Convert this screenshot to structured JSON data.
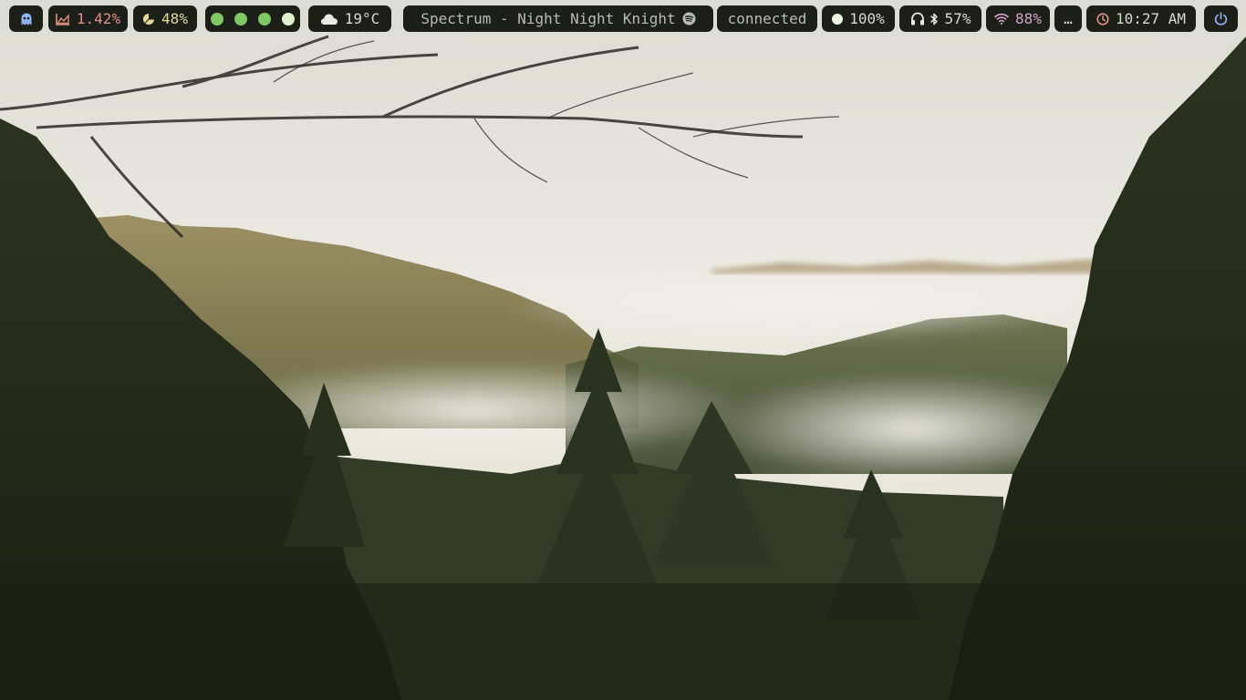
{
  "bar": {
    "launcher": {
      "icon": "ghost-icon"
    },
    "cpu": {
      "icon": "chart-area-icon",
      "value": "1.42%"
    },
    "memory": {
      "icon": "pie-chart-icon",
      "value": "48%"
    },
    "workspaces": [
      {
        "color": "#7fc864",
        "active": false
      },
      {
        "color": "#7fc864",
        "active": false
      },
      {
        "color": "#7fc864",
        "active": false
      },
      {
        "color": "#dff1cf",
        "active": true
      }
    ],
    "weather": {
      "icon": "cloud-icon",
      "value": "19°C"
    },
    "media": {
      "title": "Spectrum - Night Night Knight",
      "icon": "spotify-icon"
    },
    "vpn": {
      "status": "connected"
    },
    "brightness": {
      "icon": "brightness-dot-icon",
      "value": "100%"
    },
    "bluetooth": {
      "icons": [
        "headphones-icon",
        "bluetooth-icon"
      ],
      "value": "57%"
    },
    "wifi": {
      "icon": "wifi-icon",
      "value": "88%"
    },
    "tray": {
      "label": "…"
    },
    "clock": {
      "icon": "clock-icon",
      "value": "10:27 AM"
    },
    "power": {
      "icon": "power-icon"
    }
  },
  "colors": {
    "pill_bg": "#1b1f17",
    "red": "#e08f84",
    "yellow": "#e6d89a",
    "green": "#7fc864",
    "pink": "#d6a3cf",
    "blue": "#8fb1f0"
  }
}
